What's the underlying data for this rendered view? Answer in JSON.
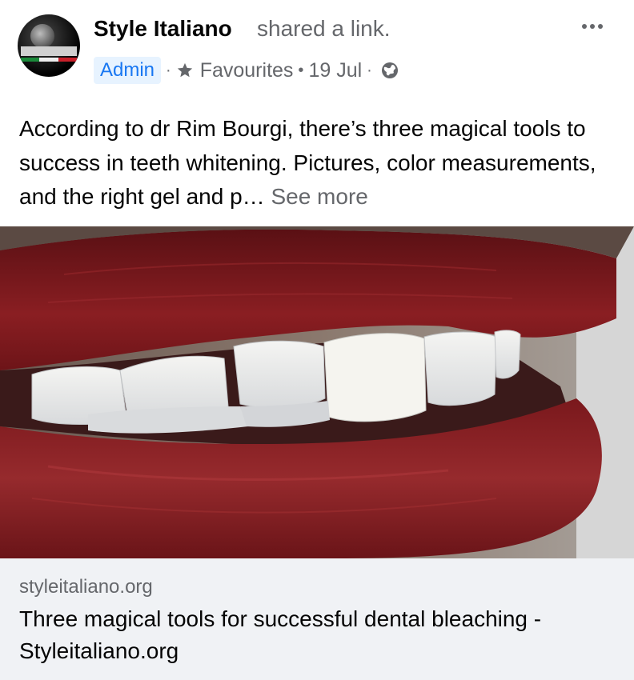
{
  "post": {
    "page_name": "Style Italiano",
    "action_text": "shared a link.",
    "badge": "Admin",
    "audience_label": "Favourites",
    "date": "19 Jul",
    "separator": "·",
    "bullet": "•",
    "body_text": "According to dr Rim Bourgi, there’s three magical tools to success in teeth whitening. Pictures, color measurements, and the right gel and p…",
    "see_more": "See more",
    "icons": {
      "more": "more-options-icon",
      "star": "star-icon",
      "globe": "globe-icon"
    }
  },
  "link_preview": {
    "domain": "styleitaliano.org",
    "title": "Three magical tools for successful dental bleaching - Styleitaliano.org"
  },
  "colors": {
    "primary_text": "#050505",
    "secondary_text": "#65676b",
    "admin_blue": "#1877f2",
    "admin_bg": "#e7f3ff",
    "link_box_bg": "#f0f2f5",
    "lip_red": "#8a1e22"
  }
}
